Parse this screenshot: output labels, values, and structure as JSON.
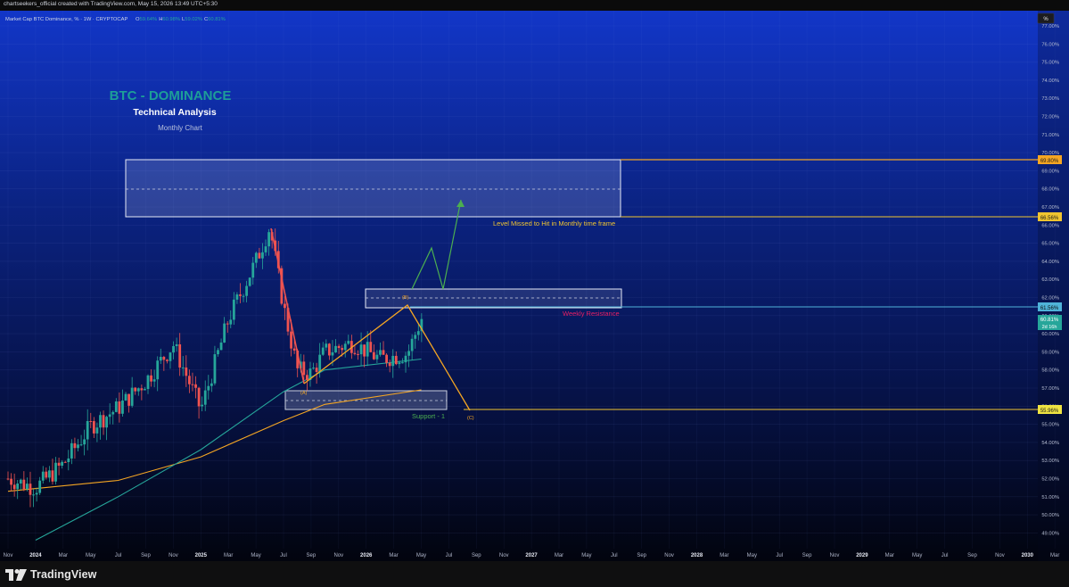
{
  "header": {
    "attribution": "chartseekers_official created with TradingView.com, May 15, 2026 13:49 UTC+5:30"
  },
  "legend": {
    "symbol": "Market Cap BTC Dominance, % · 1W · CRYPTOCAP",
    "ohlc": [
      {
        "label": "O",
        "value": "59.64%"
      },
      {
        "label": "H",
        "value": "60.98%"
      },
      {
        "label": "L",
        "value": "59.02%"
      },
      {
        "label": "C",
        "value": "60.81%"
      }
    ],
    "percent_button": "%"
  },
  "annotations": {
    "title": "BTC - DOMINANCE",
    "subtitle": "Technical Analysis",
    "caption": "Monthly Chart",
    "level_missed": "Level Missed to Hit in Monthly time frame",
    "weekly_resistance": "Weekly Resistance",
    "support": "Support - 1",
    "wave_a": "(A)",
    "wave_b": "(B)",
    "wave_c": "(C)"
  },
  "price_badges": {
    "zone_top": "69.80%",
    "zone_bottom": "66.56%",
    "resistance": "61.56%",
    "current": "60.81%",
    "countdown": "2d 16h",
    "support": "55.96%"
  },
  "branding": {
    "logo_text": "TradingView"
  },
  "colors": {
    "background_top": "#1236c8",
    "background_bottom": "#02040e",
    "candle_up": "#26a69a",
    "candle_down": "#ef5350",
    "ma_fast": "#26a69a",
    "ma_slow": "#f5a623",
    "title": "#1d9e98",
    "projection": "#f5a623",
    "target_arrow": "#4caf50",
    "level_line": "#f0c430",
    "resistance_line": "#4fb3d9",
    "resistance_text": "#e91e63",
    "support_text": "#4caf50"
  },
  "chart_data": {
    "type": "candlestick",
    "title": "",
    "y_axis": {
      "scale": "percent",
      "range": [
        48.4,
        77.4
      ],
      "ticks": [
        "77.00%",
        "76.00%",
        "75.00%",
        "74.00%",
        "73.00%",
        "72.00%",
        "71.00%",
        "70.00%",
        "69.00%",
        "68.00%",
        "67.00%",
        "66.00%",
        "65.00%",
        "64.00%",
        "63.00%",
        "62.00%",
        "61.00%",
        "60.00%",
        "59.00%",
        "58.00%",
        "57.00%",
        "56.00%",
        "55.00%",
        "54.00%",
        "53.00%",
        "52.00%",
        "51.00%",
        "50.00%",
        "49.00%"
      ]
    },
    "x_axis": {
      "labels": [
        "Nov",
        "2024",
        "Mar",
        "May",
        "Jul",
        "Sep",
        "Nov",
        "2025",
        "Mar",
        "May",
        "Jul",
        "Sep",
        "Nov",
        "2026",
        "Mar",
        "May",
        "Jul",
        "Sep",
        "Nov",
        "2027",
        "Mar",
        "May",
        "Jul",
        "Sep",
        "Nov",
        "2028",
        "Mar",
        "May",
        "Jul",
        "Sep",
        "Nov",
        "2029",
        "Mar",
        "May",
        "Jul",
        "Sep",
        "Nov",
        "2030",
        "Mar"
      ]
    },
    "candles_weekly_close_path": [
      {
        "date": "2023-11",
        "close": 52.0
      },
      {
        "date": "2024-01",
        "close": 51.5
      },
      {
        "date": "2024-03",
        "close": 52.8
      },
      {
        "date": "2024-05",
        "close": 54.9
      },
      {
        "date": "2024-07",
        "close": 55.9
      },
      {
        "date": "2024-09",
        "close": 57.4
      },
      {
        "date": "2024-11",
        "close": 59.4
      },
      {
        "date": "2025-01",
        "close": 55.8
      },
      {
        "date": "2025-03",
        "close": 60.8
      },
      {
        "date": "2025-05",
        "close": 64.0
      },
      {
        "date": "2025-06",
        "close": 65.9
      },
      {
        "date": "2025-07",
        "close": 61.5
      },
      {
        "date": "2025-08",
        "close": 58.0
      },
      {
        "date": "2025-09",
        "close": 57.8
      },
      {
        "date": "2025-10",
        "close": 59.0
      },
      {
        "date": "2025-12",
        "close": 59.5
      },
      {
        "date": "2026-02",
        "close": 58.6
      },
      {
        "date": "2026-04",
        "close": 58.9
      },
      {
        "date": "2026-05",
        "close": 60.81
      }
    ],
    "moving_averages": [
      {
        "name": "",
        "color": "#26a69a",
        "points": [
          {
            "date": "2024-01",
            "value": 48.6
          },
          {
            "date": "2024-07",
            "value": 51.0
          },
          {
            "date": "2025-01",
            "value": 53.6
          },
          {
            "date": "2025-07",
            "value": 56.8
          },
          {
            "date": "2025-10",
            "value": 58.0
          },
          {
            "date": "2026-05",
            "value": 58.6
          }
        ]
      },
      {
        "name": "",
        "color": "#f5a623",
        "points": [
          {
            "date": "2023-11",
            "value": 51.3
          },
          {
            "date": "2024-07",
            "value": 51.9
          },
          {
            "date": "2025-01",
            "value": 53.2
          },
          {
            "date": "2025-07",
            "value": 55.2
          },
          {
            "date": "2025-10",
            "value": 56.1
          },
          {
            "date": "2026-05",
            "value": 56.9
          }
        ]
      }
    ],
    "zones": [
      {
        "label": "Level Missed to Hit in Monthly time frame",
        "top": 69.8,
        "bottom": 66.56
      },
      {
        "label": "Weekly Resistance",
        "top": 62.6,
        "bottom": 61.56
      },
      {
        "label": "Support - 1",
        "top": 57.0,
        "bottom": 56.0
      }
    ],
    "levels": [
      69.8,
      66.56,
      61.56,
      55.96
    ],
    "wave_projection": [
      {
        "label": "(A)",
        "date": "2025-09",
        "value": 57.4
      },
      {
        "label": "(B)",
        "date": "2026-05",
        "value": 61.7
      },
      {
        "label": "(C)",
        "date": "2026-08",
        "value": 55.9
      }
    ],
    "target_path": [
      {
        "date": "2026-05",
        "value": 62.2
      },
      {
        "date": "2026-06",
        "value": 64.7
      },
      {
        "date": "2026-07",
        "value": 62.6
      },
      {
        "date": "2026-08",
        "value": 67.4
      }
    ]
  }
}
